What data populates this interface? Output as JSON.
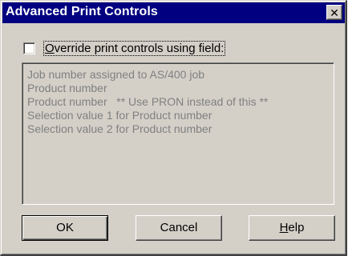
{
  "window": {
    "title": "Advanced Print Controls",
    "close_glyph": "✕"
  },
  "override": {
    "checked": false,
    "label_access_key": "O",
    "label_rest": "verride print controls using field:"
  },
  "field_list": {
    "items": [
      "Job number assigned to AS/400 job",
      "Product number",
      "Product number   ** Use PRON instead of this **",
      "Selection value 1 for Product number",
      "Selection value 2 for Product number"
    ]
  },
  "buttons": {
    "ok_label": "OK",
    "cancel_label": "Cancel",
    "help_access_key": "H",
    "help_rest": "elp"
  }
}
